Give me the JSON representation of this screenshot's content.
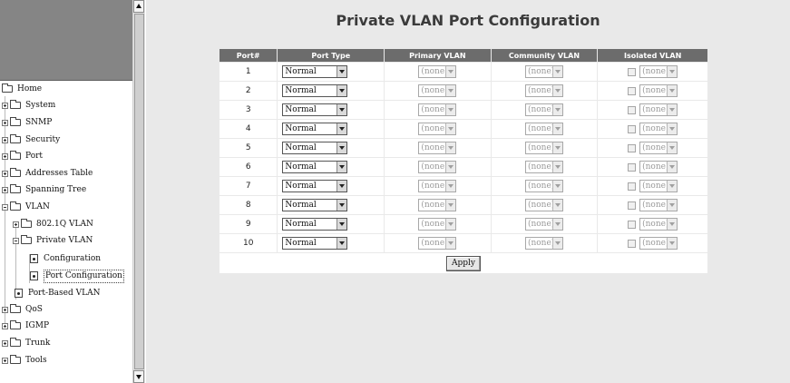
{
  "page": {
    "title": "Private VLAN Port Configuration",
    "apply_label": "Apply"
  },
  "nav": {
    "home": "Home",
    "items": [
      {
        "label": "System"
      },
      {
        "label": "SNMP"
      },
      {
        "label": "Security"
      },
      {
        "label": "Port"
      },
      {
        "label": "Addresses Table"
      },
      {
        "label": "Spanning Tree"
      },
      {
        "label": "VLAN"
      },
      {
        "label": "802.1Q VLAN"
      },
      {
        "label": "Private VLAN"
      },
      {
        "label": "Configuration"
      },
      {
        "label": "Port Configuration"
      },
      {
        "label": "Port-Based VLAN"
      },
      {
        "label": "QoS"
      },
      {
        "label": "IGMP"
      },
      {
        "label": "Trunk"
      },
      {
        "label": "Tools"
      }
    ]
  },
  "table": {
    "headers": [
      "Port#",
      "Port Type",
      "Primary VLAN",
      "Community VLAN",
      "Isolated VLAN"
    ],
    "rows": [
      {
        "port": "1",
        "type": "Normal",
        "primary": "(none)",
        "community": "(none)",
        "isolated": "(none)"
      },
      {
        "port": "2",
        "type": "Normal",
        "primary": "(none)",
        "community": "(none)",
        "isolated": "(none)"
      },
      {
        "port": "3",
        "type": "Normal",
        "primary": "(none)",
        "community": "(none)",
        "isolated": "(none)"
      },
      {
        "port": "4",
        "type": "Normal",
        "primary": "(none)",
        "community": "(none)",
        "isolated": "(none)"
      },
      {
        "port": "5",
        "type": "Normal",
        "primary": "(none)",
        "community": "(none)",
        "isolated": "(none)"
      },
      {
        "port": "6",
        "type": "Normal",
        "primary": "(none)",
        "community": "(none)",
        "isolated": "(none)"
      },
      {
        "port": "7",
        "type": "Normal",
        "primary": "(none)",
        "community": "(none)",
        "isolated": "(none)"
      },
      {
        "port": "8",
        "type": "Normal",
        "primary": "(none)",
        "community": "(none)",
        "isolated": "(none)"
      },
      {
        "port": "9",
        "type": "Normal",
        "primary": "(none)",
        "community": "(none)",
        "isolated": "(none)"
      },
      {
        "port": "10",
        "type": "Normal",
        "primary": "(none)",
        "community": "(none)",
        "isolated": "(none)"
      }
    ]
  },
  "colors": {
    "header_bg": "#6c6c6c",
    "content_bg": "#e9e9e9",
    "logo_bg": "#858585"
  }
}
